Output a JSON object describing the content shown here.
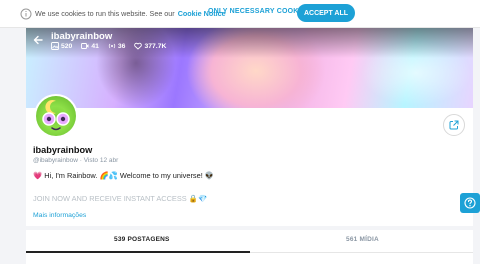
{
  "cookie_bar": {
    "message": "We use cookies to run this website. See our",
    "link": "Cookie Notice",
    "only_necessary": "ONLY NECESSARY COOKIES",
    "accept_all": "ACCEPT ALL"
  },
  "profile": {
    "cover_name": "ibabyrainbow",
    "stats": {
      "photos": "520",
      "videos": "41",
      "streams": "36",
      "likes": "377.7K"
    },
    "display_name": "ibabyrainbow",
    "handle": "@ibabyrainbow",
    "separator": "·",
    "last_seen": "Visto  12 abr",
    "bio_line1": "💗 Hi, I'm Rainbow. 🌈💦 Welcome to my universe! 👽",
    "bio_line2": "JOIN NOW AND RECEIVE INSTANT ACCESS 🔒💎",
    "more_info": "Mais informações"
  },
  "tabs": {
    "posts": "539 POSTAGENS",
    "media": "561 MÍDIA"
  },
  "colors": {
    "accent": "#1da1d6",
    "muted": "#8a96a3"
  }
}
